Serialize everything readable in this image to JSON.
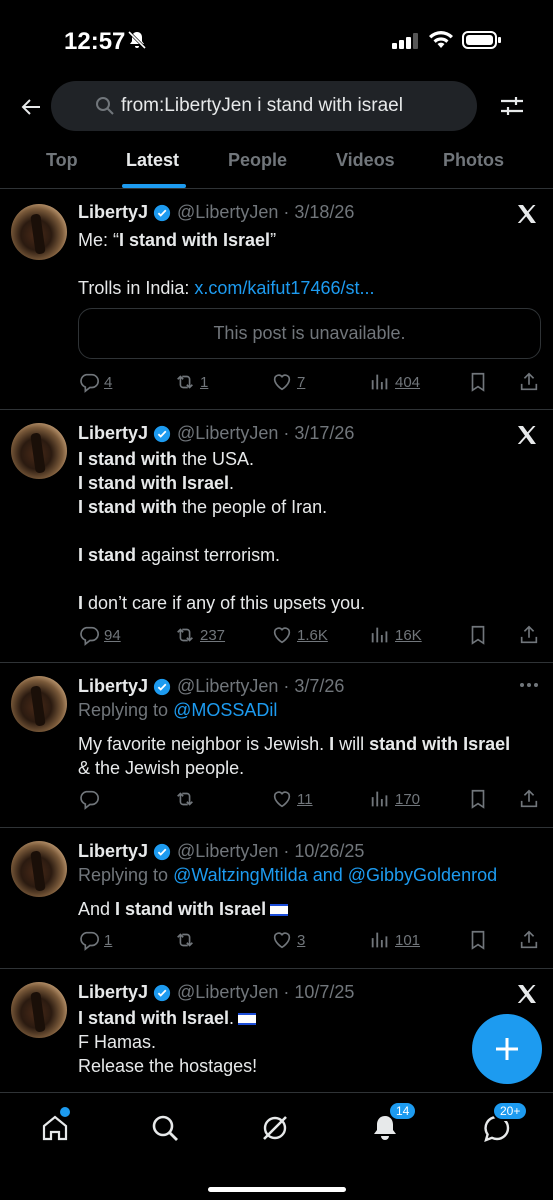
{
  "status": {
    "time": "12:57"
  },
  "search": {
    "query": "from:LibertyJen i stand with israel"
  },
  "tabs": [
    {
      "label": "Top"
    },
    {
      "label": "Latest"
    },
    {
      "label": "People"
    },
    {
      "label": "Videos"
    },
    {
      "label": "Photos"
    }
  ],
  "posts": [
    {
      "name": "LibertyJ",
      "handle": "@LibertyJen · 3/18/26",
      "line1_prefix": "Me:  “",
      "line1_bold": "I stand with Israel",
      "line1_suffix": "”",
      "line2_prefix": "Trolls in India: ",
      "line2_link": "x.com/kaifut17466/st...",
      "quoted": "This post is unavailable.",
      "replies": "4",
      "reposts": "1",
      "likes": "7",
      "views": "404"
    },
    {
      "name": "LibertyJ",
      "handle": "@LibertyJen · 3/17/26",
      "l1_bold": "I stand with",
      "l1_rest": " the USA.",
      "l2_bold": "I stand with Israel",
      "l2_rest": ".",
      "l3_bold": "I stand with",
      "l3_rest": " the people of Iran.",
      "l4_bold": "I stand",
      "l4_rest": " against terrorism.",
      "l5_bold": "I",
      "l5_rest": " don’t care if any of this upsets you.",
      "replies": "94",
      "reposts": "237",
      "likes": "1.6K",
      "views": "16K"
    },
    {
      "name": "LibertyJ",
      "handle": "@LibertyJen · 3/7/26",
      "replying_prefix": "Replying to ",
      "replying_to": "@MOSSADil",
      "t1": "My favorite neighbor is Jewish.  ",
      "t1_bold": "I",
      "t2": " will ",
      "t2_bold": "stand with Israel",
      "t3": "& the Jewish people.",
      "replies": "",
      "reposts": "",
      "likes": "11",
      "views": "170"
    },
    {
      "name": "LibertyJ",
      "handle": "@LibertyJen · 10/26/25",
      "replying_prefix": "Replying to ",
      "replying_to": "@WaltzingMtilda and @GibbyGoldenrod",
      "t1": "And ",
      "t1_bold": "I stand with Israel",
      "replies": "1",
      "reposts": "",
      "likes": "3",
      "views": "101"
    },
    {
      "name": "LibertyJ",
      "handle": "@LibertyJen · 10/7/25",
      "l1_bold": "I stand with Israel",
      "l1_rest": ".",
      "l2": "F Hamas.",
      "l3": "Release the hostages!"
    }
  ],
  "nav": {
    "notifications_badge": "14",
    "messages_badge": "20+"
  },
  "colors": {
    "accent": "#1d9bf0",
    "muted": "#71767b",
    "bg": "#000000"
  }
}
